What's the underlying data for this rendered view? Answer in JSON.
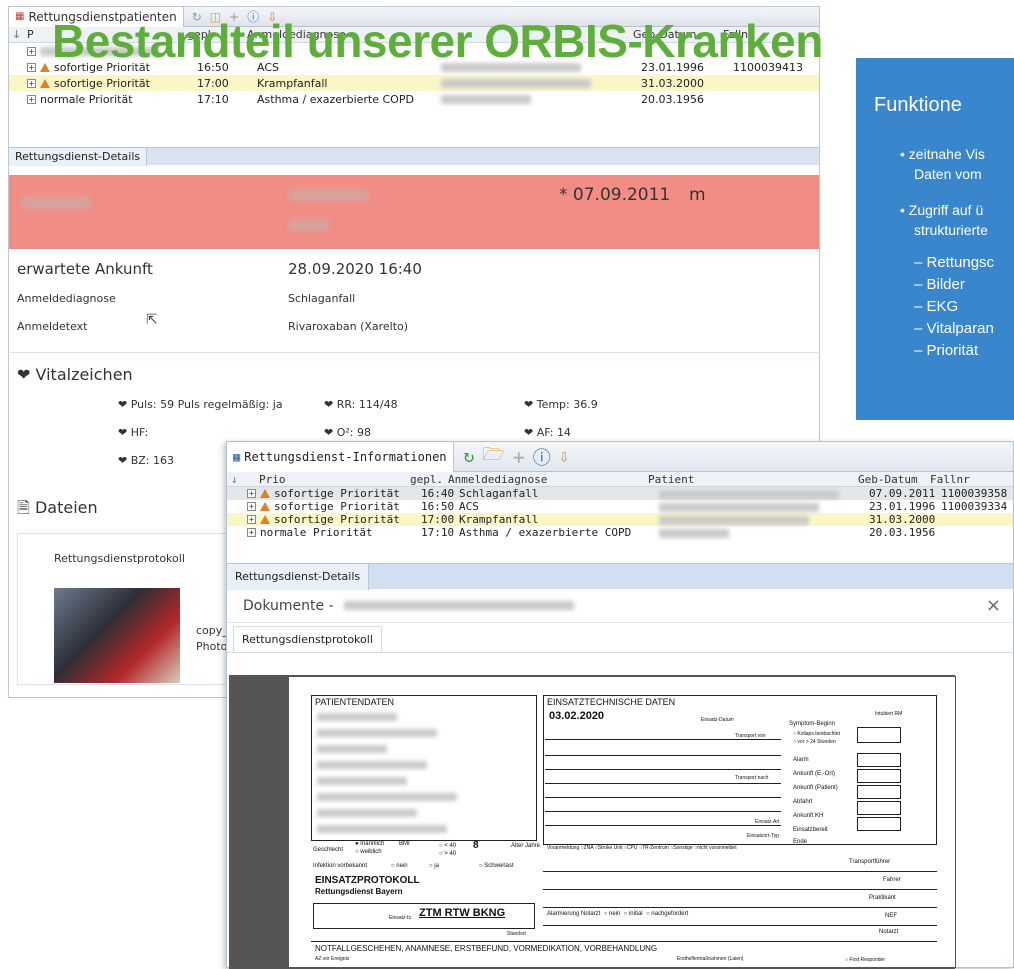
{
  "overlay_title": "Bestandteil unserer ORBIS-Kranken",
  "back_window": {
    "tab_title": "Rettungsdienstpatienten",
    "columns": {
      "prio": "P",
      "gepl": "gepl.",
      "anmeldediagnose": "Anmeldediagnose",
      "geb_datum": "Geb-Datum",
      "fallnr": "Fallnr"
    },
    "rows": [
      {
        "prio": "sofortige Priorität",
        "gepl": "16:50",
        "diag": "ACS",
        "geb": "23.01.1996",
        "fallnr": "1100039413"
      },
      {
        "prio": "sofortige Priorität",
        "gepl": "17:00",
        "diag": "Krampfanfall",
        "geb": "31.03.2000",
        "fallnr": ""
      },
      {
        "prio": "normale Priorität",
        "gepl": "17:10",
        "diag": "Asthma / exazerbierte COPD",
        "geb": "20.03.1956",
        "fallnr": ""
      }
    ],
    "details_tab": "Rettungsdienst-Details",
    "patient_dob": "* 07.09.2011",
    "patient_sex": "m",
    "expected_arrival_label": "erwartete Ankunft",
    "expected_arrival_value": "28.09.2020 16:40",
    "anmeldediagnose_label": "Anmeldediagnose",
    "anmeldediagnose_value": "Schlaganfall",
    "anmeldetext_label": "Anmeldetext",
    "anmeldetext_value": "Rivaroxaban (Xarelto)",
    "vitals_title": "Vitalzeichen",
    "vitals": {
      "puls": "Puls:",
      "puls_value": "59 Puls regelmäßig: ja",
      "rr": "RR:",
      "rr_value": "114/48",
      "temp": "Temp:",
      "temp_value": "36.9",
      "hf": "HF:",
      "o2": "O²:",
      "o2_value": "98",
      "af": "AF:",
      "af_value": "14",
      "bz": "BZ:",
      "bz_value": "163"
    },
    "files_title": "Dateien",
    "file_label": "Rettungsdienstprotokoll",
    "file_name_1": "copy_",
    "file_name_2": "Photo"
  },
  "front_window": {
    "tab_title": "Rettungsdienst-Informationen",
    "columns": {
      "prio": "Prio",
      "gepl": "gepl.",
      "anmeldediagnose": "Anmeldediagnose",
      "patient": "Patient",
      "geb_datum": "Geb-Datum",
      "fallnr": "Fallnr"
    },
    "rows": [
      {
        "prio": "sofortige Priorität",
        "gepl": "16:40",
        "diag": "Schlaganfall",
        "geb": "07.09.2011",
        "fallnr": "1100039358"
      },
      {
        "prio": "sofortige Priorität",
        "gepl": "16:50",
        "diag": "ACS",
        "geb": "23.01.1996",
        "fallnr": "1100039334"
      },
      {
        "prio": "sofortige Priorität",
        "gepl": "17:00",
        "diag": "Krampfanfall",
        "geb": "31.03.2000",
        "fallnr": ""
      },
      {
        "prio": "normale Priorität",
        "gepl": "17:10",
        "diag": "Asthma / exazerbierte COPD",
        "geb": "20.03.1956",
        "fallnr": ""
      }
    ],
    "details_tab": "Rettungsdienst-Details",
    "documents_title": "Dokumente -",
    "close": "×",
    "doc_tab": "Rettungsdienstprotokoll"
  },
  "protocol": {
    "patientendaten": "PATIENTENDATEN",
    "einsatztechnische": "EINSATZTECHNISCHE DATEN",
    "date": "03.02.2020",
    "einsatz_datum": "Einsatz-Datum",
    "intubiert": "Intubiert RM",
    "symptom_beginn": "Symptom-Beginn",
    "kollaps": "Kollaps beobachtet",
    "vor24": "vor > 24 Stunden",
    "transport_von": "Transport von",
    "transport_nach": "Transport nach",
    "einsatz_art": "Einsatz-Art",
    "einsatzort_typ": "Einsatzort-Typ",
    "alarm": "Alarm",
    "ankunft_eort": "Ankunft (E.-Ort)",
    "ankunft_patient": "Ankunft (Patient)",
    "abfahrt": "Abfahrt",
    "ankunft_kh": "Ankunft KH",
    "einsatzbereit": "Einsatzbereit",
    "ende": "Ende",
    "geschlecht": "Geschlecht",
    "maennlich": "männlich",
    "weiblich": "weiblich",
    "bmi": "BMI",
    "lt40": "< 40",
    "gt40": "> 40",
    "age": "8",
    "alter_jahre": "Alter Jahre",
    "infektion": "Infektion vorbekannt",
    "nein": "nein",
    "ja": "ja",
    "schwerlast": "Schwerlast",
    "voranmeldung": "Voranmeldung",
    "einsatzprotokoll": "EINSATZPROTOKOLL",
    "rettungsdienst_bayern": "Rettungsdienst Bayern",
    "einsatz_fz": "Einsatz-fz.",
    "vehicle": "ZTM RTW BKNG",
    "standort": "Standort",
    "alarmierung": "Alarmierung Notarzt",
    "initial": "initial",
    "nachgefordert": "nachgefordert",
    "transportfuehrer": "Transportführer",
    "fahrer": "Fahrer",
    "praktikant": "Praktikant",
    "nef": "NEF",
    "notarzt": "Notarzt",
    "notfallgeschehen": "NOTFALLGESCHEHEN, ANAMNESE, ERSTBEFUND, VORMEDIKATION, VORBEHANDLUNG",
    "az_vor_ereignis": "AZ vor Ereignis",
    "ersthelfer": "Ersthelfermaßnahmen (Laien)",
    "first_responder": "First Responder"
  },
  "blue_panel": {
    "title": "Funktione",
    "bullet1_l1": "zeitnahe Vis",
    "bullet1_l2": "Daten vom",
    "bullet2_l1": "Zugriff auf ü",
    "bullet2_l2": "strukturierte",
    "sub1": "– Rettungsc",
    "sub2": "– Bilder",
    "sub3": "– EKG",
    "sub4": "– Vitalparan",
    "sub5": "– Priorität"
  }
}
